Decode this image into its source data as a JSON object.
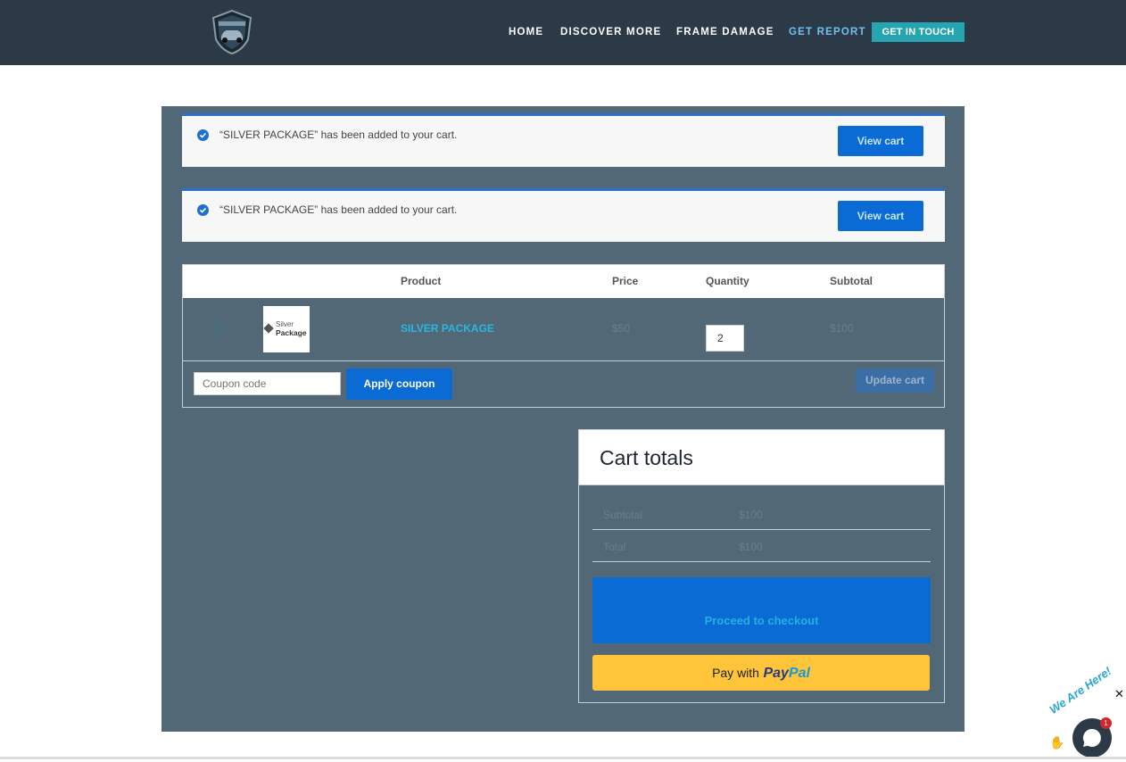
{
  "nav": {
    "items": [
      {
        "label": "HOME",
        "active": false
      },
      {
        "label": "DISCOVER MORE",
        "active": false
      },
      {
        "label": "FRAME DAMAGE",
        "active": false
      },
      {
        "label": "GET REPORT",
        "active": true
      }
    ],
    "cta": "GET IN TOUCH"
  },
  "notices": [
    {
      "message": "“SILVER PACKAGE” has been added to your cart.",
      "button": "View cart"
    },
    {
      "message": "“SILVER PACKAGE” has been added to your cart.",
      "button": "View cart"
    }
  ],
  "cart": {
    "headers": {
      "product": "Product",
      "price": "Price",
      "quantity": "Quantity",
      "subtotal": "Subtotal"
    },
    "row": {
      "thumb_line1": "Silver",
      "thumb_line2": "Package",
      "product": "SILVER PACKAGE",
      "price": "$50",
      "quantity": "2",
      "subtotal": "$100"
    },
    "coupon_placeholder": "Coupon code",
    "apply_label": "Apply coupon",
    "update_label": "Update cart"
  },
  "totals": {
    "title": "Cart totals",
    "subtotal_label": "Subtotal",
    "subtotal_value": "$100",
    "total_label": "Total",
    "total_value": "$100",
    "checkout_label": "Proceed to checkout",
    "paypal_prefix": "Pay with",
    "paypal_brand_1": "Pay",
    "paypal_brand_2": "Pal"
  },
  "chat": {
    "badge_text": "We Are Here!",
    "count": "1",
    "close": "✕"
  },
  "colors": {
    "header_bg": "#2c3a47",
    "panel_bg": "#536876",
    "accent_blue": "#0a6bd4",
    "cta_teal": "#25a5b0",
    "paypal_yellow": "#ffc439"
  }
}
